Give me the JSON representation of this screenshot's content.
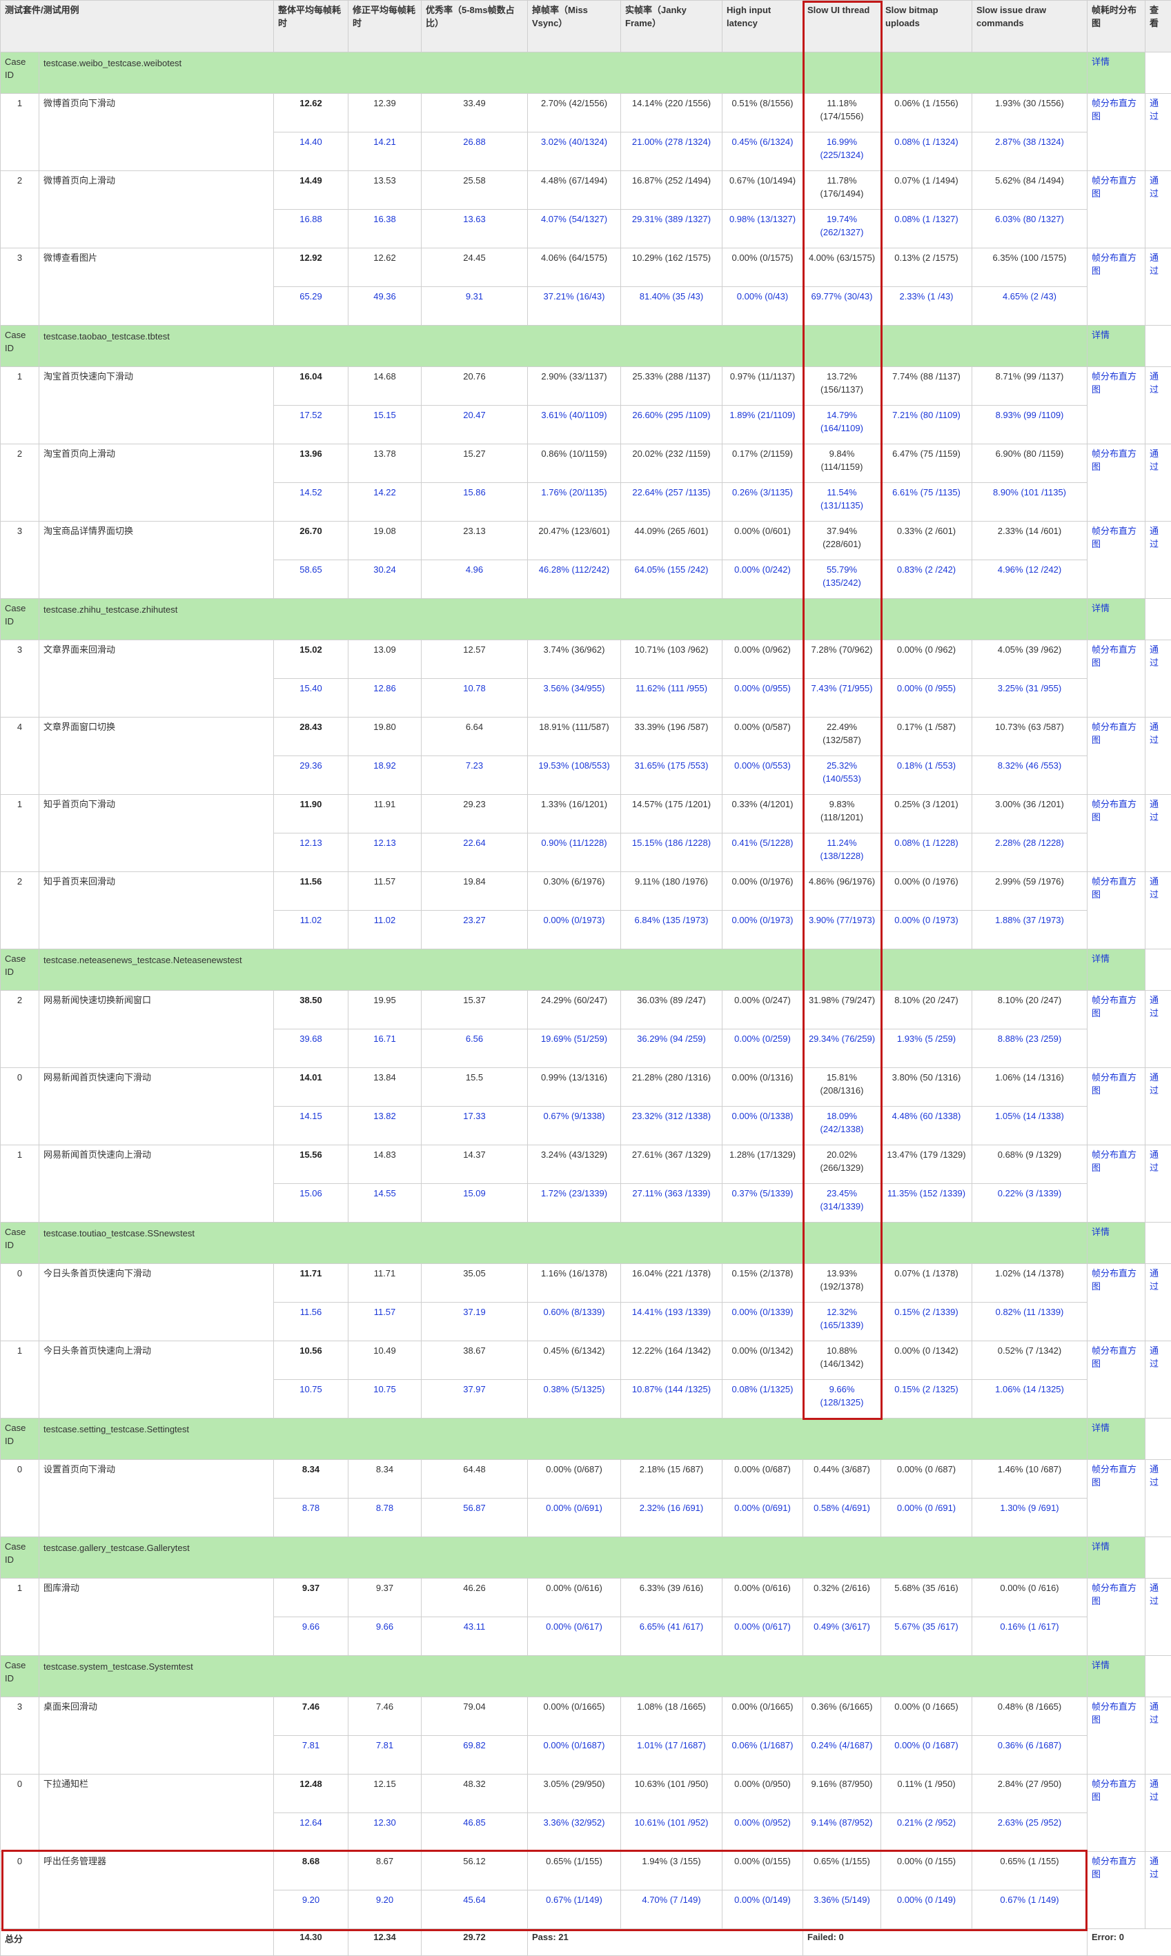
{
  "header": {
    "suite_case": "测试套件/测试用例",
    "avg_frame": "整体平均每帧耗时",
    "adj_avg_frame": "修正平均每帧耗时",
    "excellent_rate": "优秀率（5-8ms帧数占比）",
    "miss_vsync": "掉帧率（Miss Vsync）",
    "janky": "实帧率（Janky Frame）",
    "high_input": "High input latency",
    "slow_ui": "Slow UI thread",
    "slow_bitmap": "Slow bitmap uploads",
    "slow_draw": "Slow issue draw commands",
    "distribution": "帧耗时分布图",
    "view": "查看"
  },
  "labels": {
    "case_id": "Case ID",
    "detail": "详情",
    "dist_link": "帧分布直方图",
    "pass": "通过"
  },
  "colors": {
    "suite_bg": "#b8e8b0",
    "link": "#1a37d8",
    "highlight": "#c21818",
    "header_bg": "#eeeeee"
  },
  "suites": [
    {
      "name": "testcase.weibo_testcase.weibotest",
      "cases": [
        {
          "id": "1",
          "name": "微博首页向下滑动",
          "r1": [
            "12.62",
            "12.39",
            "33.49",
            "2.70% (42/1556)",
            "14.14% (220 /1556)",
            "0.51% (8/1556)",
            "11.18% (174/1556)",
            "0.06% (1 /1556)",
            "1.93% (30 /1556)"
          ],
          "r2": [
            "14.40",
            "14.21",
            "26.88",
            "3.02% (40/1324)",
            "21.00% (278 /1324)",
            "0.45% (6/1324)",
            "16.99% (225/1324)",
            "0.08% (1 /1324)",
            "2.87% (38 /1324)"
          ]
        },
        {
          "id": "2",
          "name": "微博首页向上滑动",
          "r1": [
            "14.49",
            "13.53",
            "25.58",
            "4.48% (67/1494)",
            "16.87% (252 /1494)",
            "0.67% (10/1494)",
            "11.78% (176/1494)",
            "0.07% (1 /1494)",
            "5.62% (84 /1494)"
          ],
          "r2": [
            "16.88",
            "16.38",
            "13.63",
            "4.07% (54/1327)",
            "29.31% (389 /1327)",
            "0.98% (13/1327)",
            "19.74% (262/1327)",
            "0.08% (1 /1327)",
            "6.03% (80 /1327)"
          ]
        },
        {
          "id": "3",
          "name": "微博查看图片",
          "r1": [
            "12.92",
            "12.62",
            "24.45",
            "4.06% (64/1575)",
            "10.29% (162 /1575)",
            "0.00% (0/1575)",
            "4.00% (63/1575)",
            "0.13% (2 /1575)",
            "6.35% (100 /1575)"
          ],
          "r2": [
            "65.29",
            "49.36",
            "9.31",
            "37.21% (16/43)",
            "81.40% (35 /43)",
            "0.00% (0/43)",
            "69.77% (30/43)",
            "2.33% (1 /43)",
            "4.65% (2 /43)"
          ]
        }
      ]
    },
    {
      "name": "testcase.taobao_testcase.tbtest",
      "cases": [
        {
          "id": "1",
          "name": "淘宝首页快速向下滑动",
          "r1": [
            "16.04",
            "14.68",
            "20.76",
            "2.90% (33/1137)",
            "25.33% (288 /1137)",
            "0.97% (11/1137)",
            "13.72% (156/1137)",
            "7.74% (88 /1137)",
            "8.71% (99 /1137)"
          ],
          "r2": [
            "17.52",
            "15.15",
            "20.47",
            "3.61% (40/1109)",
            "26.60% (295 /1109)",
            "1.89% (21/1109)",
            "14.79% (164/1109)",
            "7.21% (80 /1109)",
            "8.93% (99 /1109)"
          ]
        },
        {
          "id": "2",
          "name": "淘宝首页向上滑动",
          "r1": [
            "13.96",
            "13.78",
            "15.27",
            "0.86% (10/1159)",
            "20.02% (232 /1159)",
            "0.17% (2/1159)",
            "9.84% (114/1159)",
            "6.47% (75 /1159)",
            "6.90% (80 /1159)"
          ],
          "r2": [
            "14.52",
            "14.22",
            "15.86",
            "1.76% (20/1135)",
            "22.64% (257 /1135)",
            "0.26% (3/1135)",
            "11.54% (131/1135)",
            "6.61% (75 /1135)",
            "8.90% (101 /1135)"
          ]
        },
        {
          "id": "3",
          "name": "淘宝商品详情界面切换",
          "r1": [
            "26.70",
            "19.08",
            "23.13",
            "20.47% (123/601)",
            "44.09% (265 /601)",
            "0.00% (0/601)",
            "37.94% (228/601)",
            "0.33% (2 /601)",
            "2.33% (14 /601)"
          ],
          "r2": [
            "58.65",
            "30.24",
            "4.96",
            "46.28% (112/242)",
            "64.05% (155 /242)",
            "0.00% (0/242)",
            "55.79% (135/242)",
            "0.83% (2 /242)",
            "4.96% (12 /242)"
          ]
        }
      ]
    },
    {
      "name": "testcase.zhihu_testcase.zhihutest",
      "cases": [
        {
          "id": "3",
          "name": "文章界面来回滑动",
          "r1": [
            "15.02",
            "13.09",
            "12.57",
            "3.74% (36/962)",
            "10.71% (103 /962)",
            "0.00% (0/962)",
            "7.28% (70/962)",
            "0.00% (0 /962)",
            "4.05% (39 /962)"
          ],
          "r2": [
            "15.40",
            "12.86",
            "10.78",
            "3.56% (34/955)",
            "11.62% (111 /955)",
            "0.00% (0/955)",
            "7.43% (71/955)",
            "0.00% (0 /955)",
            "3.25% (31 /955)"
          ]
        },
        {
          "id": "4",
          "name": "文章界面窗口切换",
          "r1": [
            "28.43",
            "19.80",
            "6.64",
            "18.91% (111/587)",
            "33.39% (196 /587)",
            "0.00% (0/587)",
            "22.49% (132/587)",
            "0.17% (1 /587)",
            "10.73% (63 /587)"
          ],
          "r2": [
            "29.36",
            "18.92",
            "7.23",
            "19.53% (108/553)",
            "31.65% (175 /553)",
            "0.00% (0/553)",
            "25.32% (140/553)",
            "0.18% (1 /553)",
            "8.32% (46 /553)"
          ]
        },
        {
          "id": "1",
          "name": "知乎首页向下滑动",
          "r1": [
            "11.90",
            "11.91",
            "29.23",
            "1.33% (16/1201)",
            "14.57% (175 /1201)",
            "0.33% (4/1201)",
            "9.83% (118/1201)",
            "0.25% (3 /1201)",
            "3.00% (36 /1201)"
          ],
          "r2": [
            "12.13",
            "12.13",
            "22.64",
            "0.90% (11/1228)",
            "15.15% (186 /1228)",
            "0.41% (5/1228)",
            "11.24% (138/1228)",
            "0.08% (1 /1228)",
            "2.28% (28 /1228)"
          ]
        },
        {
          "id": "2",
          "name": "知乎首页来回滑动",
          "r1": [
            "11.56",
            "11.57",
            "19.84",
            "0.30% (6/1976)",
            "9.11% (180 /1976)",
            "0.00% (0/1976)",
            "4.86% (96/1976)",
            "0.00% (0 /1976)",
            "2.99% (59 /1976)"
          ],
          "r2": [
            "11.02",
            "11.02",
            "23.27",
            "0.00% (0/1973)",
            "6.84% (135 /1973)",
            "0.00% (0/1973)",
            "3.90% (77/1973)",
            "0.00% (0 /1973)",
            "1.88% (37 /1973)"
          ]
        }
      ]
    },
    {
      "name": "testcase.neteasenews_testcase.Neteasenewstest",
      "cases": [
        {
          "id": "2",
          "name": "网易新闻快速切换新闻窗口",
          "r1": [
            "38.50",
            "19.95",
            "15.37",
            "24.29% (60/247)",
            "36.03% (89 /247)",
            "0.00% (0/247)",
            "31.98% (79/247)",
            "8.10% (20 /247)",
            "8.10% (20 /247)"
          ],
          "r2": [
            "39.68",
            "16.71",
            "6.56",
            "19.69% (51/259)",
            "36.29% (94 /259)",
            "0.00% (0/259)",
            "29.34% (76/259)",
            "1.93% (5 /259)",
            "8.88% (23 /259)"
          ]
        },
        {
          "id": "0",
          "name": "网易新闻首页快速向下滑动",
          "r1": [
            "14.01",
            "13.84",
            "15.5",
            "0.99% (13/1316)",
            "21.28% (280 /1316)",
            "0.00% (0/1316)",
            "15.81% (208/1316)",
            "3.80% (50 /1316)",
            "1.06% (14 /1316)"
          ],
          "r2": [
            "14.15",
            "13.82",
            "17.33",
            "0.67% (9/1338)",
            "23.32% (312 /1338)",
            "0.00% (0/1338)",
            "18.09% (242/1338)",
            "4.48% (60 /1338)",
            "1.05% (14 /1338)"
          ]
        },
        {
          "id": "1",
          "name": "网易新闻首页快速向上滑动",
          "r1": [
            "15.56",
            "14.83",
            "14.37",
            "3.24% (43/1329)",
            "27.61% (367 /1329)",
            "1.28% (17/1329)",
            "20.02% (266/1329)",
            "13.47% (179 /1329)",
            "0.68% (9 /1329)"
          ],
          "r2": [
            "15.06",
            "14.55",
            "15.09",
            "1.72% (23/1339)",
            "27.11% (363 /1339)",
            "0.37% (5/1339)",
            "23.45% (314/1339)",
            "11.35% (152 /1339)",
            "0.22% (3 /1339)"
          ]
        }
      ]
    },
    {
      "name": "testcase.toutiao_testcase.SSnewstest",
      "cases": [
        {
          "id": "0",
          "name": "今日头条首页快速向下滑动",
          "r1": [
            "11.71",
            "11.71",
            "35.05",
            "1.16% (16/1378)",
            "16.04% (221 /1378)",
            "0.15% (2/1378)",
            "13.93% (192/1378)",
            "0.07% (1 /1378)",
            "1.02% (14 /1378)"
          ],
          "r2": [
            "11.56",
            "11.57",
            "37.19",
            "0.60% (8/1339)",
            "14.41% (193 /1339)",
            "0.00% (0/1339)",
            "12.32% (165/1339)",
            "0.15% (2 /1339)",
            "0.82% (11 /1339)"
          ]
        },
        {
          "id": "1",
          "name": "今日头条首页快速向上滑动",
          "r1": [
            "10.56",
            "10.49",
            "38.67",
            "0.45% (6/1342)",
            "12.22% (164 /1342)",
            "0.00% (0/1342)",
            "10.88% (146/1342)",
            "0.00% (0 /1342)",
            "0.52% (7 /1342)"
          ],
          "r2": [
            "10.75",
            "10.75",
            "37.97",
            "0.38% (5/1325)",
            "10.87% (144 /1325)",
            "0.08% (1/1325)",
            "9.66% (128/1325)",
            "0.15% (2 /1325)",
            "1.06% (14 /1325)"
          ]
        }
      ]
    },
    {
      "name": "testcase.setting_testcase.Settingtest",
      "cases": [
        {
          "id": "0",
          "name": "设置首页向下滑动",
          "r1": [
            "8.34",
            "8.34",
            "64.48",
            "0.00% (0/687)",
            "2.18% (15 /687)",
            "0.00% (0/687)",
            "0.44% (3/687)",
            "0.00% (0 /687)",
            "1.46% (10 /687)"
          ],
          "r2": [
            "8.78",
            "8.78",
            "56.87",
            "0.00% (0/691)",
            "2.32% (16 /691)",
            "0.00% (0/691)",
            "0.58% (4/691)",
            "0.00% (0 /691)",
            "1.30% (9 /691)"
          ]
        }
      ]
    },
    {
      "name": "testcase.gallery_testcase.Gallerytest",
      "cases": [
        {
          "id": "1",
          "name": "图库滑动",
          "r1": [
            "9.37",
            "9.37",
            "46.26",
            "0.00% (0/616)",
            "6.33% (39 /616)",
            "0.00% (0/616)",
            "0.32% (2/616)",
            "5.68% (35 /616)",
            "0.00% (0 /616)"
          ],
          "r2": [
            "9.66",
            "9.66",
            "43.11",
            "0.00% (0/617)",
            "6.65% (41 /617)",
            "0.00% (0/617)",
            "0.49% (3/617)",
            "5.67% (35 /617)",
            "0.16% (1 /617)"
          ]
        }
      ]
    },
    {
      "name": "testcase.system_testcase.Systemtest",
      "cases": [
        {
          "id": "3",
          "name": "桌面来回滑动",
          "r1": [
            "7.46",
            "7.46",
            "79.04",
            "0.00% (0/1665)",
            "1.08% (18 /1665)",
            "0.00% (0/1665)",
            "0.36% (6/1665)",
            "0.00% (0 /1665)",
            "0.48% (8 /1665)"
          ],
          "r2": [
            "7.81",
            "7.81",
            "69.82",
            "0.00% (0/1687)",
            "1.01% (17 /1687)",
            "0.06% (1/1687)",
            "0.24% (4/1687)",
            "0.00% (0 /1687)",
            "0.36% (6 /1687)"
          ]
        },
        {
          "id": "0",
          "name": "下拉通知栏",
          "r1": [
            "12.48",
            "12.15",
            "48.32",
            "3.05% (29/950)",
            "10.63% (101 /950)",
            "0.00% (0/950)",
            "9.16% (87/950)",
            "0.11% (1 /950)",
            "2.84% (27 /950)"
          ],
          "r2": [
            "12.64",
            "12.30",
            "46.85",
            "3.36% (32/952)",
            "10.61% (101 /952)",
            "0.00% (0/952)",
            "9.14% (87/952)",
            "0.21% (2 /952)",
            "2.63% (25 /952)"
          ]
        },
        {
          "id": "0",
          "name": "呼出任务管理器",
          "r1": [
            "8.68",
            "8.67",
            "56.12",
            "0.65% (1/155)",
            "1.94% (3 /155)",
            "0.00% (0/155)",
            "0.65% (1/155)",
            "0.00% (0 /155)",
            "0.65% (1 /155)"
          ],
          "r2": [
            "9.20",
            "9.20",
            "45.64",
            "0.67% (1/149)",
            "4.70% (7 /149)",
            "0.00% (0/149)",
            "3.36% (5/149)",
            "0.00% (0 /149)",
            "0.67% (1 /149)"
          ]
        }
      ]
    }
  ],
  "footer": {
    "total_label": "总分",
    "avg": "14.30",
    "adj_avg": "12.34",
    "excellent": "29.72",
    "pass": "Pass: 21",
    "failed": "Failed: 0",
    "error": "Error: 0"
  }
}
